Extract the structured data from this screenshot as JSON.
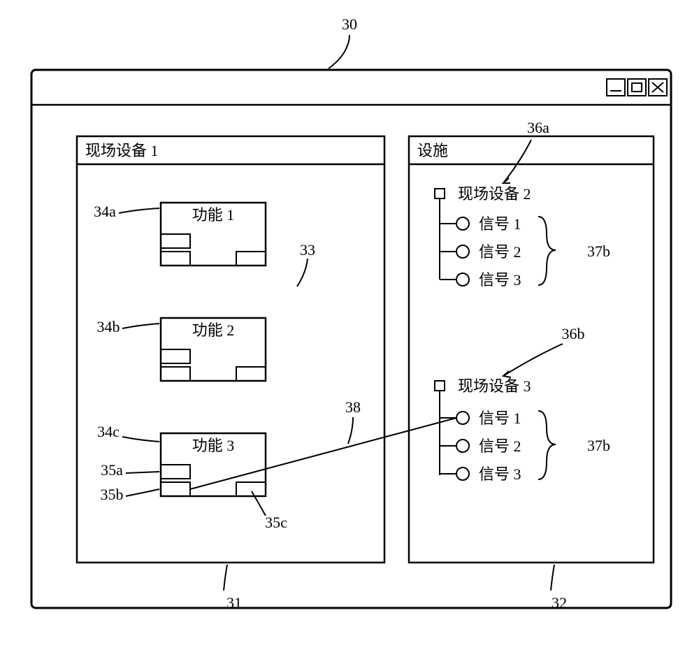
{
  "refs": {
    "window": "30",
    "leftPanel": "31",
    "rightPanel": "32",
    "canvas": "33",
    "block1": "34a",
    "block2": "34b",
    "block3": "34c",
    "port3a": "35a",
    "port3b": "35b",
    "port3c": "35c",
    "device2": "36a",
    "device3": "36b",
    "signals2": "37b",
    "signals3": "37b",
    "link": "38"
  },
  "leftPanelTitle": "现场设备 1",
  "rightPanelTitle": "设施",
  "blocks": {
    "b1": "功能 1",
    "b2": "功能 2",
    "b3": "功能 3"
  },
  "tree": {
    "dev2": {
      "title": "现场设备 2",
      "signals": [
        "信号 1",
        "信号 2",
        "信号 3"
      ]
    },
    "dev3": {
      "title": "现场设备 3",
      "signals": [
        "信号 1",
        "信号 2",
        "信号 3"
      ]
    }
  },
  "winButtons": [
    "–",
    "☐",
    "×"
  ]
}
